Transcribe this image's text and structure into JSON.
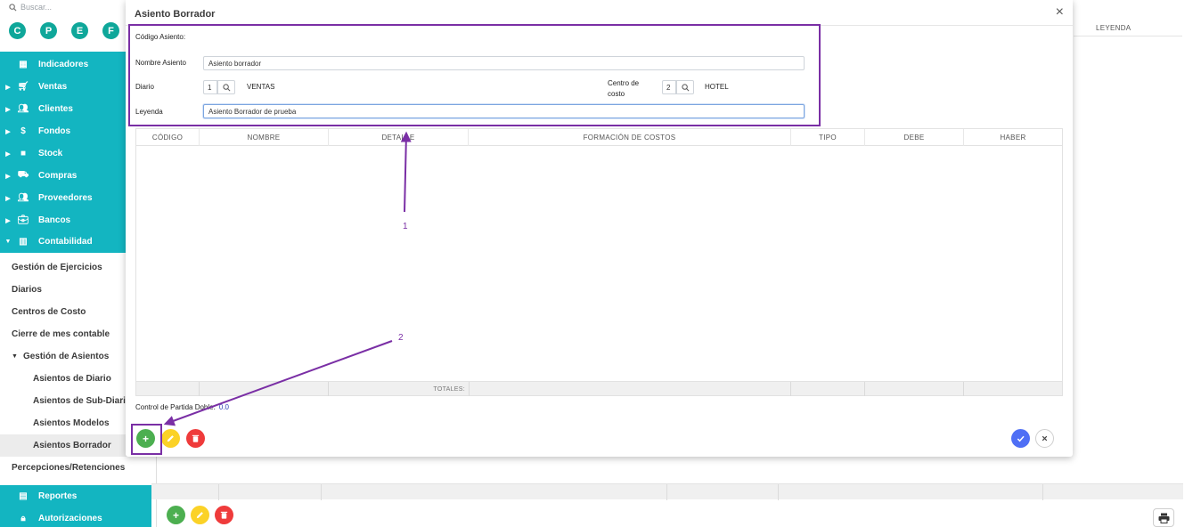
{
  "sidebar": {
    "search_placeholder": "Buscar...",
    "quick_links": [
      "C",
      "P",
      "E",
      "F"
    ],
    "items": [
      {
        "label": "Indicadores",
        "icon": "grid-icon"
      },
      {
        "label": "Ventas",
        "icon": "cart-icon"
      },
      {
        "label": "Clientes",
        "icon": "people-icon"
      },
      {
        "label": "Fondos",
        "icon": "dollar-icon"
      },
      {
        "label": "Stock",
        "icon": "box-icon"
      },
      {
        "label": "Compras",
        "icon": "shopping-cart-icon"
      },
      {
        "label": "Proveedores",
        "icon": "people-icon"
      },
      {
        "label": "Bancos",
        "icon": "briefcase-icon"
      },
      {
        "label": "Contabilidad",
        "icon": "book-icon"
      }
    ],
    "contabilidad_sub": [
      "Gestión de Ejercicios",
      "Diarios",
      "Centros de Costo",
      "Cierre de mes contable",
      "Gestión de Asientos"
    ],
    "asientos_sub": [
      "Asientos de Diario",
      "Asientos de Sub-Diario",
      "Asientos Modelos",
      "Asientos Borrador"
    ],
    "percepciones": "Percepciones/Retenciones",
    "reportes": "Reportes",
    "autorizaciones": "Autorizaciones"
  },
  "background": {
    "leyenda_header": "LEYENDA"
  },
  "modal": {
    "title": "Asiento Borrador",
    "close_symbol": "×",
    "form": {
      "codigo_label": "Código Asiento:",
      "nombre_label": "Nombre Asiento",
      "nombre_value": "Asiento borrador",
      "diario_label": "Diario",
      "diario_code": "1",
      "diario_name": "VENTAS",
      "centro_label_1": "Centro de",
      "centro_label_2": "costo",
      "centro_code": "2",
      "centro_name": "HOTEL",
      "leyenda_label": "Leyenda",
      "leyenda_value": "Asiento Borrador de prueba"
    },
    "table": {
      "columns": [
        "CÓDIGO",
        "NOMBRE",
        "DETALLE",
        "FORMACIÓN DE COSTOS",
        "TIPO",
        "DEBE",
        "HABER"
      ],
      "totales_label": "TOTALES:"
    },
    "control_label": "Control de Partida Doble:",
    "control_value": "0.0"
  },
  "annotations": {
    "label_1": "1",
    "label_2": "2",
    "color": "#7a2fa5"
  },
  "colors": {
    "sidebar_teal": "#13b5c1",
    "quick_link": "#0fa79a",
    "add": "#4caf50",
    "edit": "#fbd227",
    "delete": "#ef3b3b",
    "confirm": "#4f6ff5"
  }
}
